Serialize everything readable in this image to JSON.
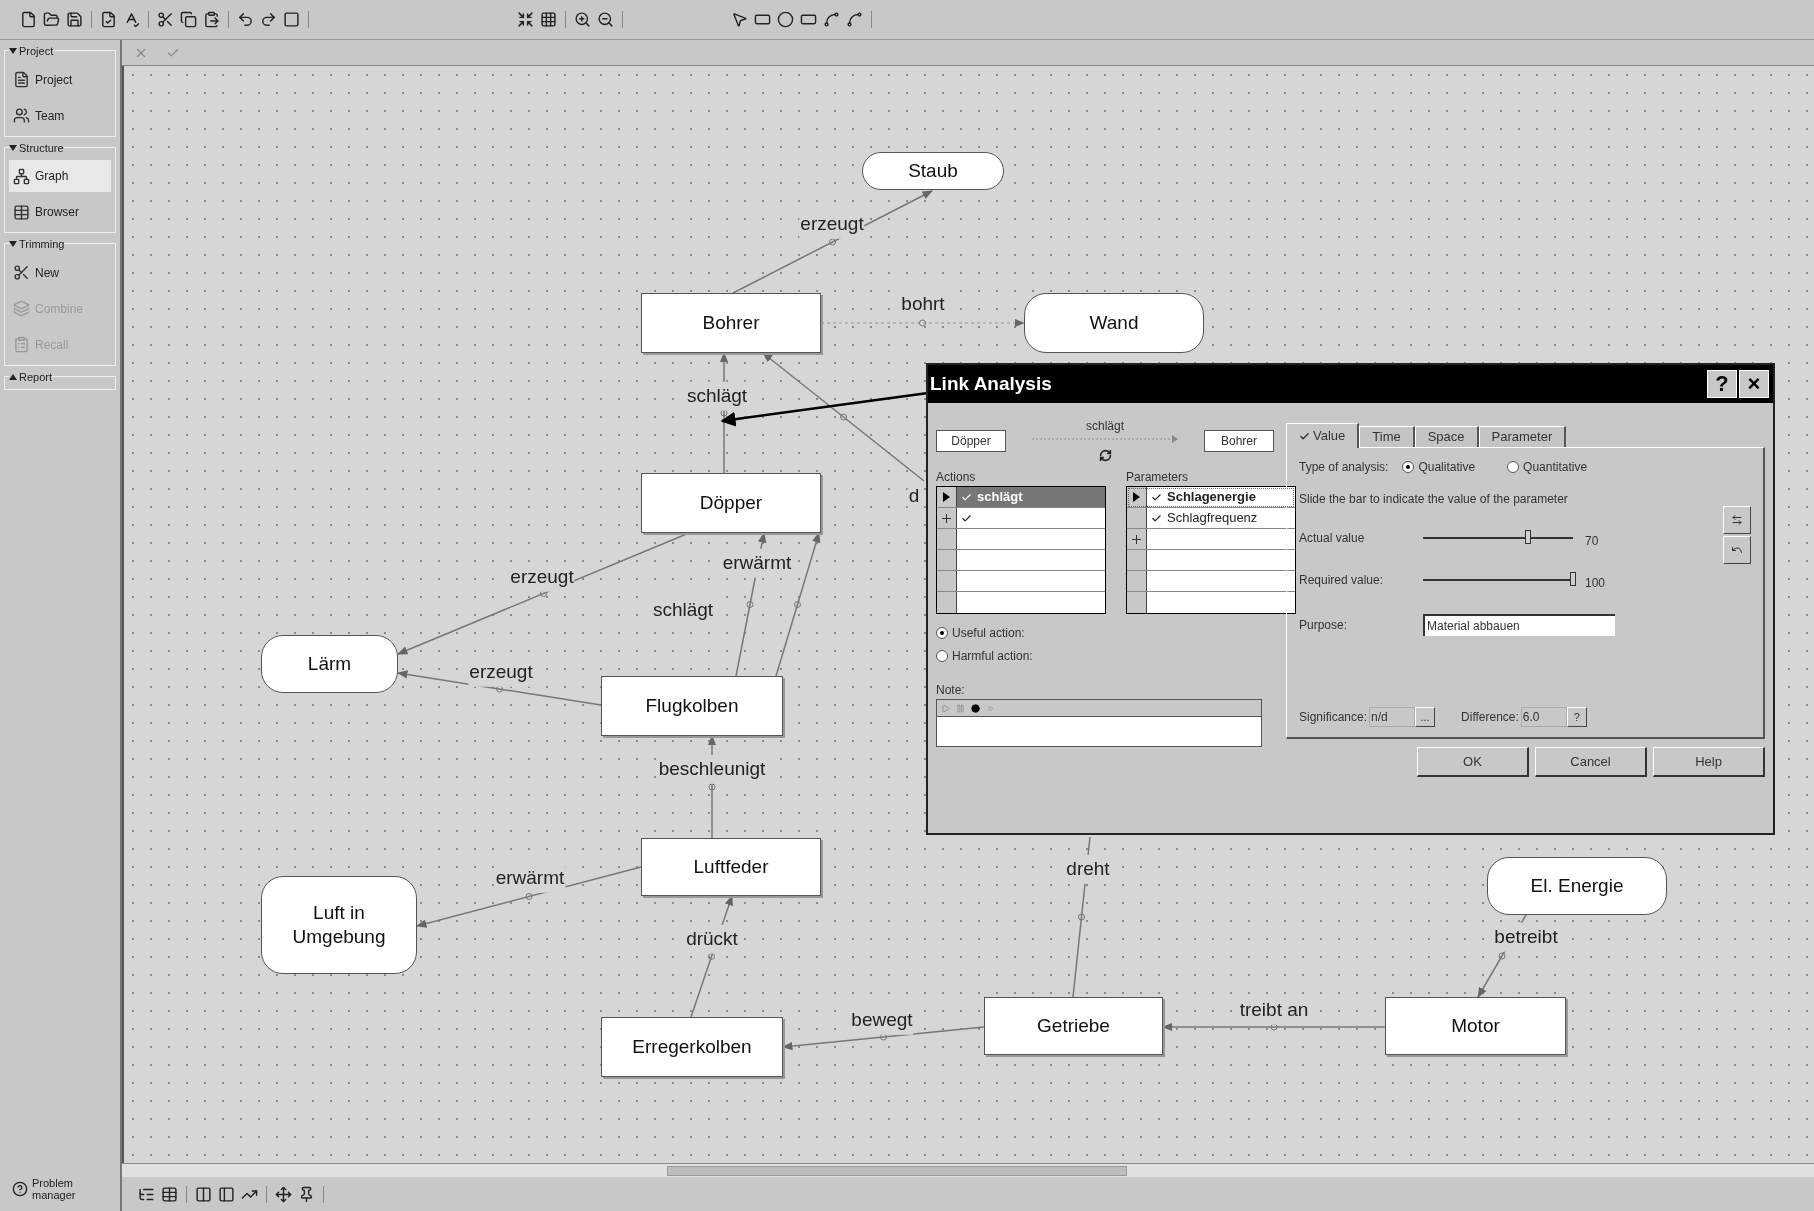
{
  "sidebar": {
    "groups": [
      {
        "title": "Project",
        "expanded": true,
        "items": [
          {
            "label": "Project",
            "selected": false,
            "disabled": false
          },
          {
            "label": "Team",
            "selected": false,
            "disabled": false
          }
        ]
      },
      {
        "title": "Structure",
        "expanded": true,
        "items": [
          {
            "label": "Graph",
            "selected": true,
            "disabled": false
          },
          {
            "label": "Browser",
            "selected": false,
            "disabled": false
          }
        ]
      },
      {
        "title": "Trimming",
        "expanded": true,
        "items": [
          {
            "label": "New",
            "selected": false,
            "disabled": false
          },
          {
            "label": "Combine",
            "selected": false,
            "disabled": true
          },
          {
            "label": "Recall",
            "selected": false,
            "disabled": true
          }
        ]
      },
      {
        "title": "Report",
        "expanded": false
      }
    ],
    "problem_manager": "Problem manager"
  },
  "graph": {
    "nodes": [
      {
        "label": "Staub",
        "kind": "supersystem"
      },
      {
        "label": "Bohrer",
        "kind": "system"
      },
      {
        "label": "Wand",
        "kind": "supersystem"
      },
      {
        "label": "Döpper",
        "kind": "system"
      },
      {
        "label": "Lärm",
        "kind": "supersystem"
      },
      {
        "label": "Flugkolben",
        "kind": "system"
      },
      {
        "label": "Luftfeder",
        "kind": "system"
      },
      {
        "label": "El. Energie",
        "kind": "supersystem"
      },
      {
        "label": "Luft in Umgebung",
        "kind": "supersystem"
      },
      {
        "label": "Erregerkolben",
        "kind": "system"
      },
      {
        "label": "Getriebe",
        "kind": "system"
      },
      {
        "label": "Motor",
        "kind": "system"
      }
    ],
    "edges": [
      {
        "label": "erzeugt",
        "kind": "solid"
      },
      {
        "label": "bohrt",
        "kind": "dashed"
      },
      {
        "label": "schlägt",
        "kind": "solid"
      },
      {
        "label": "d",
        "kind": "solid"
      },
      {
        "label": "erzeugt",
        "kind": "solid"
      },
      {
        "label": "erwärmt",
        "kind": "solid"
      },
      {
        "label": "schlägt",
        "kind": "solid"
      },
      {
        "label": "erzeugt",
        "kind": "solid"
      },
      {
        "label": "beschleunigt",
        "kind": "solid"
      },
      {
        "label": "erwärmt",
        "kind": "solid"
      },
      {
        "label": "drückt",
        "kind": "solid"
      },
      {
        "label": "dreht",
        "kind": "solid"
      },
      {
        "label": "bewegt",
        "kind": "solid"
      },
      {
        "label": "treibt an",
        "kind": "solid"
      },
      {
        "label": "betreibt",
        "kind": "solid"
      }
    ]
  },
  "dialog": {
    "title": "Link Analysis",
    "title_buttons": [
      "?",
      "×"
    ],
    "link": {
      "source": "Döpper",
      "action": "schlägt",
      "target": "Bohrer"
    },
    "actions": {
      "heading": "Actions",
      "rows": [
        {
          "kind": "current",
          "label": "schlägt",
          "checked": true,
          "selected": true
        },
        {
          "kind": "new",
          "checked": true,
          "selected": false
        },
        {
          "kind": "empty",
          "checked": false,
          "selected": false
        },
        {
          "kind": "empty",
          "checked": false,
          "selected": false
        },
        {
          "kind": "empty",
          "checked": false,
          "selected": false
        },
        {
          "kind": "empty",
          "checked": false,
          "selected": false
        }
      ]
    },
    "parameters": {
      "heading": "Parameters",
      "rows": [
        {
          "kind": "current",
          "label": "Schlagenergie",
          "checked": true,
          "selected": true
        },
        {
          "kind": "plain",
          "label": "Schlagfrequenz",
          "checked": true,
          "selected": false
        },
        {
          "kind": "new",
          "checked": false,
          "selected": false
        },
        {
          "kind": "empty",
          "checked": false,
          "selected": false
        },
        {
          "kind": "empty",
          "checked": false,
          "selected": false
        },
        {
          "kind": "empty",
          "checked": false,
          "selected": false
        }
      ]
    },
    "action_type": [
      {
        "label": "Useful action:",
        "selected": true
      },
      {
        "label": "Harmful action:",
        "selected": false
      }
    ],
    "note": {
      "label": "Note:"
    },
    "tabs": [
      {
        "label": "Value",
        "selected": true,
        "checked": true
      },
      {
        "label": "Time",
        "selected": false,
        "checked": false
      },
      {
        "label": "Space",
        "selected": false,
        "checked": false
      },
      {
        "label": "Parameter",
        "selected": false,
        "checked": false
      }
    ],
    "analysis": {
      "label": "Type of analysis:",
      "options": [
        {
          "label": "Qualitative",
          "selected": true
        },
        {
          "label": "Quantitative",
          "selected": false
        }
      ]
    },
    "hint": "Slide the bar to indicate the value of the parameter",
    "sliders": [
      {
        "label": "Actual value",
        "level": 0.7,
        "reading": "70"
      },
      {
        "label": "Required value:",
        "level": 1,
        "reading": "100"
      }
    ],
    "purpose": {
      "label": "Purpose:",
      "value": "Material abbauen"
    },
    "significance": {
      "label": "Significance:",
      "value": "n/d",
      "button": "..."
    },
    "difference": {
      "label": "Difference:",
      "value": "6.0",
      "button": "?"
    },
    "buttons": [
      "OK",
      "Cancel",
      "Help"
    ]
  }
}
